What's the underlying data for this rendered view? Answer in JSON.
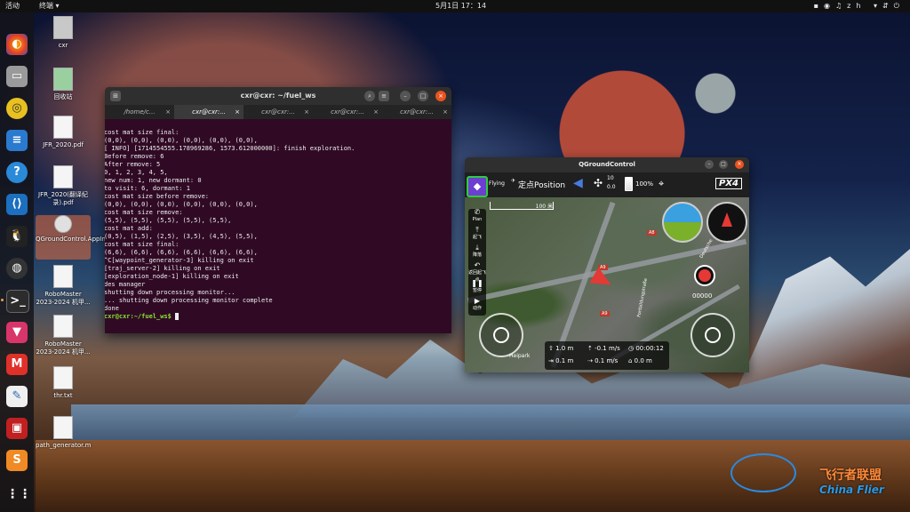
{
  "topbar": {
    "activities": "活动",
    "app_name": "终端 ▾",
    "clock": "5月1日 17：14",
    "tray_icons": [
      "camera-icon",
      "sync-icon",
      "volume-icon",
      "network-icon",
      "zh-icon",
      "power-icon"
    ],
    "lang": "zh ▾"
  },
  "dock": {
    "items": [
      "firefox-icon",
      "files-icon",
      "rhythmbox-icon",
      "document-icon",
      "help-icon",
      "vscode-icon",
      "qq-icon",
      "obs-icon",
      "terminal-icon",
      "remmina-icon",
      "app-m-icon",
      "text-editor-icon",
      "screenshot-icon",
      "sublime-icon",
      "show-apps-icon"
    ]
  },
  "desktop": {
    "icons": [
      {
        "label": "cxr"
      },
      {
        "label": "回收站"
      },
      {
        "label": "JFR_2020.pdf"
      },
      {
        "label": "JFR_2020(翻译纪录).pdf"
      },
      {
        "label": "QGroundControl.AppImage"
      },
      {
        "label": "RoboMaster 2023-2024 机甲..."
      },
      {
        "label": "RoboMaster 2023-2024 机甲..."
      },
      {
        "label": "thr.txt"
      },
      {
        "label": "path_generator.m"
      }
    ]
  },
  "terminal": {
    "title": "cxr@cxr: ~/fuel_ws",
    "tabs": [
      "/home/c...",
      "cxr@cxr:...",
      "cxr@cxr:...",
      "cxr@cxr:...",
      "cxr@cxr:..."
    ],
    "lines": [
      "cost mat size final:",
      "(0,0), (0,0), (0,0), (0,0), (0,0), (0,0),",
      "[ INFO] [1714554555.178969286, 1573.612000000]: finish exploration.",
      "Before remove: 6",
      "After remove: 5",
      "0, 1, 2, 3, 4, 5,",
      "new num: 1, new dormant: 0",
      "to visit: 6, dormant: 1",
      "cost mat size before remove:",
      "(0,0), (0,0), (0,0), (0,0), (0,0), (0,0),",
      "cost mat size remove:",
      "(5,5), (5,5), (5,5), (5,5), (5,5),",
      "cost mat add:",
      "(0,5), (1,5), (2,5), (3,5), (4,5), (5,5),",
      "cost mat size final:",
      "(6,6), (6,6), (6,6), (6,6), (6,6), (6,6),",
      "^C[waypoint_generator-3] killing on exit",
      "[traj_server-2] killing on exit",
      "[exploration_node-1] killing on exit",
      "des manager",
      "shutting down processing monitor...",
      "... shutting down processing monitor complete",
      "done"
    ],
    "prompt": "cxr@cxr:~/fuel_ws$"
  },
  "qgc": {
    "title": "QGroundControl",
    "status": "Flying",
    "flight_mode": "定点Position",
    "rc_count_top": "10",
    "rc_count_bottom": "0.0",
    "battery": "100%",
    "brand": "PX4",
    "scale": "100 米",
    "record_timer": "00000",
    "map_labels": [
      "A9",
      "A8",
      "Heipark",
      "Fortbildungstraße",
      "A9",
      "Deutsche"
    ],
    "left_tools": [
      {
        "icon": "plan-icon",
        "label": "Plan"
      },
      {
        "icon": "takeoff-icon",
        "label": "起飞"
      },
      {
        "icon": "land-icon",
        "label": "降落"
      },
      {
        "icon": "rtl-icon",
        "label": "返回起飞点"
      },
      {
        "icon": "pause-icon",
        "label": "暂停"
      },
      {
        "icon": "action-icon",
        "label": "动作"
      }
    ],
    "telemetry": {
      "alt_up": "1.0 m",
      "vspeed": "-0.1 m/s",
      "time": "00:00:12",
      "dist": "0.1 m",
      "hspeed": "0.1 m/s",
      "dist_home": "0.0 m"
    }
  },
  "watermark": {
    "line1": "飞行者联盟",
    "line2": "China Flier"
  }
}
